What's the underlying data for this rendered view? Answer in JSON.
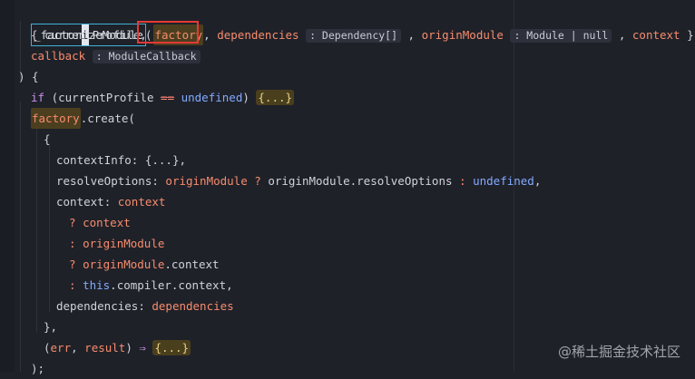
{
  "code": {
    "l1_fn_prefix": "_factor",
    "l1_fn_caret": "i",
    "l1_fn_suffix": "zeModule",
    "l1_paren": "(",
    "l2_open": "{ ",
    "l2_currentProfile": "currentProfile",
    "l2_comma1": ",",
    "l2_factory": "factory",
    "l2_comma2": ",",
    "l2_dependencies": "dependencies",
    "l2_dep_hint": ": Dependency[]",
    "l2_comma3": " ,",
    "l2_originModule": "originModule",
    "l2_om_hint": ": Module | null",
    "l2_comma4": " ,",
    "l2_context": "context",
    "l2_close": " },",
    "l3_callback": "callback",
    "l3_cb_hint": ": ModuleCallback",
    "l4": ") {",
    "l5_if": "if",
    "l5_open": " (",
    "l5_currentProfile": "currentProfile",
    "l5_op": "==",
    "l5_undefined": "undefined",
    "l5_close": ") ",
    "l5_fold": "{...}",
    "l6_factory": "factory",
    "l6_create": ".create(",
    "l7": "{",
    "l8_contextInfo": "contextInfo",
    "l8_rest": ": ",
    "l8_fold": "{...}",
    "l8_comma": ",",
    "l9_resolveOptions": "resolveOptions",
    "l9_colon": ": ",
    "l9_originModule": "originModule",
    "l9_q": " ? ",
    "l9_originModule2": "originModule",
    "l9_prop": ".resolveOptions",
    "l9_colon2": " : ",
    "l9_undefined": "undefined",
    "l9_comma": ",",
    "l10_context": "context",
    "l10_colon": ": ",
    "l10_value": "context",
    "l11_q": "? ",
    "l11_value": "context",
    "l12_colon": ": ",
    "l12_value": "originModule",
    "l13_q": "? ",
    "l13_obj": "originModule",
    "l13_prop": ".context",
    "l14_colon": ": ",
    "l14_this": "this",
    "l14_rest": ".compiler.context,",
    "l15_dependencies": "dependencies",
    "l15_colon": ": ",
    "l15_value": "dependencies",
    "l16": "},",
    "l17_open": "(",
    "l17_err": "err",
    "l17_comma": ", ",
    "l17_result": "result",
    "l17_close": ") ",
    "l17_arrow": "⇒",
    "l17_space": " ",
    "l17_fold": "{...}",
    "l18": ");"
  },
  "watermark": "@稀土掘金技术社区"
}
